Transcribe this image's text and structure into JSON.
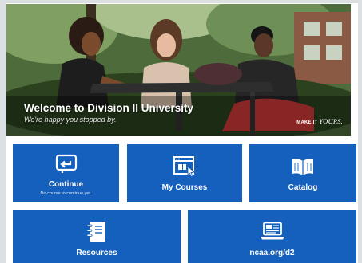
{
  "hero": {
    "title": "Welcome to Division II University",
    "subtitle": "We're happy you stopped by.",
    "tagline_prefix": "MAKE IT ",
    "tagline_accent": "YOURS."
  },
  "tiles": [
    {
      "label": "Continue",
      "sub": "No course to continue yet.",
      "icon": "continue-arrow-icon"
    },
    {
      "label": "My Courses",
      "icon": "course-window-cursor-icon"
    },
    {
      "label": "Catalog",
      "icon": "open-book-icon"
    },
    {
      "label": "Resources",
      "icon": "notebook-icon"
    },
    {
      "label": "ncaa.org/d2",
      "icon": "laptop-icon"
    }
  ],
  "colors": {
    "tile_blue": "#1560bd",
    "page_bg": "#dcdfe2"
  }
}
